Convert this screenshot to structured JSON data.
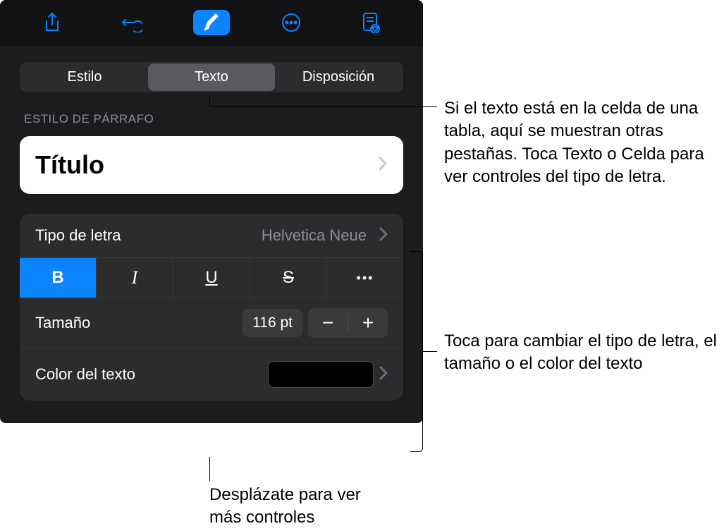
{
  "segmented": {
    "item0": "Estilo",
    "item1": "Texto",
    "item2": "Disposición",
    "active": 1
  },
  "sectionHeader": "Estilo de párrafo",
  "paragraphStyle": {
    "label": "Título"
  },
  "font": {
    "label": "Tipo de letra",
    "value": "Helvetica Neue"
  },
  "format": {
    "bold": "B",
    "italic": "I",
    "underline": "U",
    "strike": "S",
    "more": "•••"
  },
  "size": {
    "label": "Tamaño",
    "value": "116 pt",
    "minus": "−",
    "plus": "+"
  },
  "textColor": {
    "label": "Color del texto",
    "value": "#000000"
  },
  "callouts": {
    "c1": "Si el texto está en la celda de una tabla, aquí se muestran otras pestañas. Toca Texto o Celda para ver controles del tipo de letra.",
    "c2": "Toca para cambiar el tipo de letra, el tamaño o el color del texto",
    "c3": "Desplázate para ver más controles"
  }
}
